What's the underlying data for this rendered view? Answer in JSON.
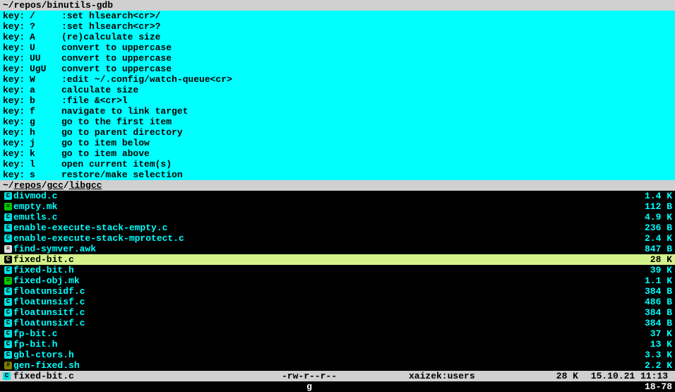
{
  "top_title": " ~/repos/binutils-gdb",
  "help_rows": [
    {
      "key": "/",
      "desc": ":set hlsearch<cr>/"
    },
    {
      "key": "?",
      "desc": ":set hlsearch<cr>?"
    },
    {
      "key": "A",
      "desc": "(re)calculate size"
    },
    {
      "key": "U",
      "desc": "convert to uppercase"
    },
    {
      "key": "UU",
      "desc": "convert to uppercase"
    },
    {
      "key": "UgU",
      "desc": "convert to uppercase"
    },
    {
      "key": "W",
      "desc": ":edit ~/.config/watch-queue<cr>"
    },
    {
      "key": "a",
      "desc": "calculate size"
    },
    {
      "key": "b",
      "desc": ":file &<cr>l"
    },
    {
      "key": "f",
      "desc": "navigate to link target"
    },
    {
      "key": "g",
      "desc": "go to the first item"
    },
    {
      "key": "h",
      "desc": "go to parent directory"
    },
    {
      "key": "j",
      "desc": "go to item below"
    },
    {
      "key": "k",
      "desc": "go to item above"
    },
    {
      "key": "l",
      "desc": "open current item(s)"
    },
    {
      "key": "s",
      "desc": "restore/make selection"
    }
  ],
  "key_label": "key:",
  "path_prefix": " ~/",
  "path_parts": [
    "repos",
    "gcc",
    "libgcc"
  ],
  "files": [
    {
      "icon": "C",
      "cls": "badge-c",
      "name": "divmod.c",
      "size": "1.4 K",
      "sel": false
    },
    {
      "icon": "≡",
      "cls": "badge-mk",
      "name": "empty.mk",
      "size": "112 B",
      "sel": false
    },
    {
      "icon": "C",
      "cls": "badge-c",
      "name": "emutls.c",
      "size": "4.9 K",
      "sel": false
    },
    {
      "icon": "C",
      "cls": "badge-c",
      "name": "enable-execute-stack-empty.c",
      "size": "236 B",
      "sel": false
    },
    {
      "icon": "C",
      "cls": "badge-c",
      "name": "enable-execute-stack-mprotect.c",
      "size": "2.4 K",
      "sel": false
    },
    {
      "icon": "≡",
      "cls": "badge-awk",
      "name": "find-symver.awk",
      "size": "847 B",
      "sel": false
    },
    {
      "icon": "C",
      "cls": "badge-c",
      "name": "fixed-bit.c",
      "size": "28 K",
      "sel": true
    },
    {
      "icon": "C",
      "cls": "badge-c",
      "name": "fixed-bit.h",
      "size": "39 K",
      "sel": false
    },
    {
      "icon": "≡",
      "cls": "badge-mk",
      "name": "fixed-obj.mk",
      "size": "1.1 K",
      "sel": false
    },
    {
      "icon": "C",
      "cls": "badge-c",
      "name": "floatunsidf.c",
      "size": "384 B",
      "sel": false
    },
    {
      "icon": "C",
      "cls": "badge-c",
      "name": "floatunsisf.c",
      "size": "486 B",
      "sel": false
    },
    {
      "icon": "C",
      "cls": "badge-c",
      "name": "floatunsitf.c",
      "size": "384 B",
      "sel": false
    },
    {
      "icon": "C",
      "cls": "badge-c",
      "name": "floatunsixf.c",
      "size": "384 B",
      "sel": false
    },
    {
      "icon": "C",
      "cls": "badge-c",
      "name": "fp-bit.c",
      "size": "37 K",
      "sel": false
    },
    {
      "icon": "C",
      "cls": "badge-c",
      "name": "fp-bit.h",
      "size": "13 K",
      "sel": false
    },
    {
      "icon": "C",
      "cls": "badge-c",
      "name": "gbl-ctors.h",
      "size": "3.3 K",
      "sel": false
    },
    {
      "icon": "#",
      "cls": "badge-sh",
      "name": "gen-fixed.sh",
      "size": "2.2 K",
      "sel": false
    }
  ],
  "status": {
    "icon": "C",
    "name": "fixed-bit.c",
    "perm": "-rw-r--r--",
    "owner": "xaizek:users",
    "size": "28 K",
    "date": "15.10.21 11:13"
  },
  "cmd": {
    "center": "g",
    "right": "18-78"
  }
}
